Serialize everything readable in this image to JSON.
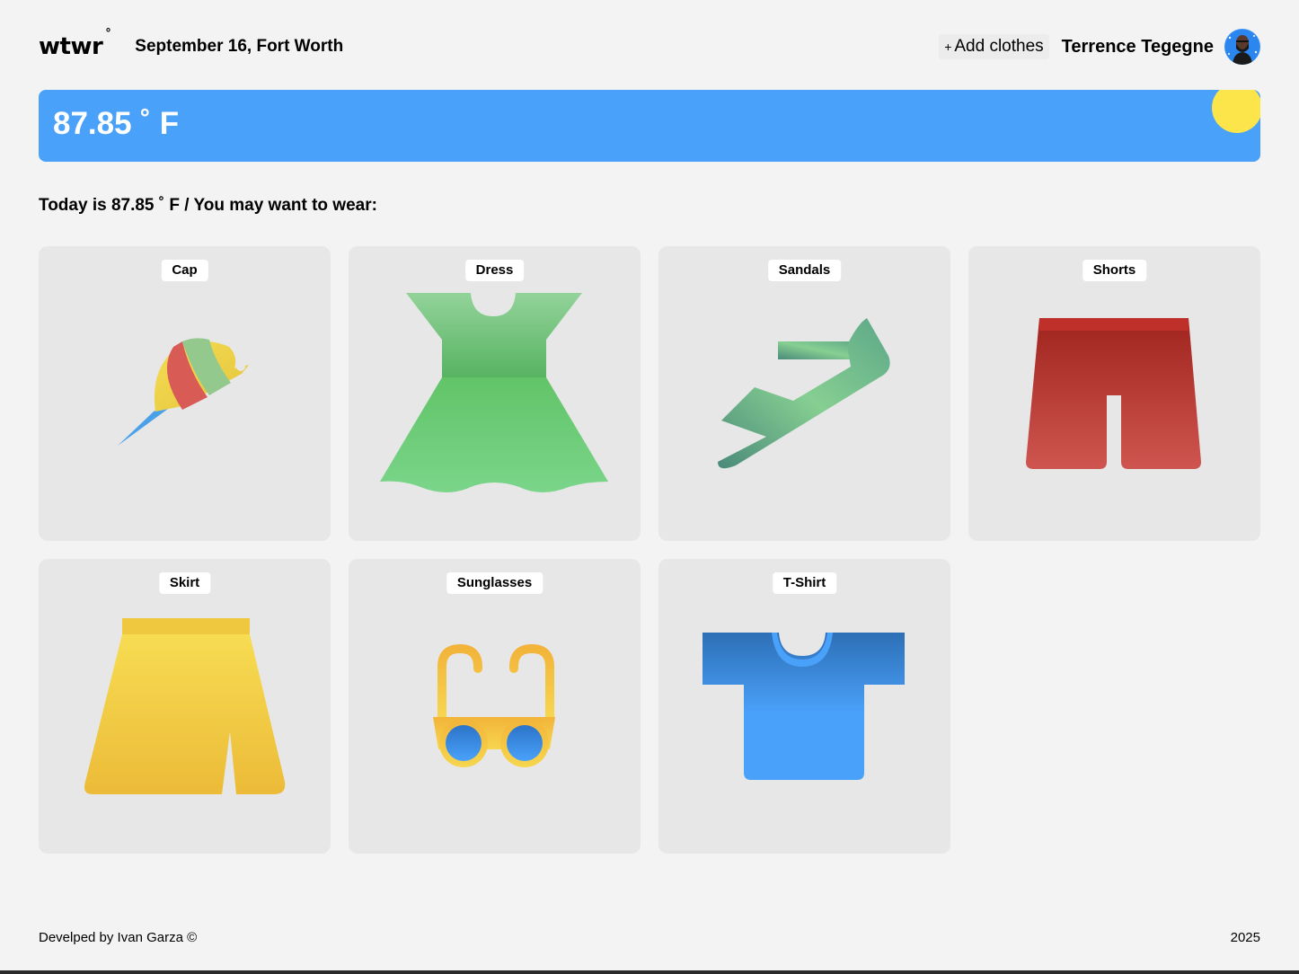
{
  "header": {
    "logo": "wtwr",
    "logo_degree": "°",
    "date_location": "September 16, Fort Worth",
    "add_button_icon": "+",
    "add_button_label": "Add clothes",
    "username": "Terrence Tegegne",
    "avatar_icon": "user-avatar"
  },
  "weather": {
    "temperature": "87.85 ˚ F",
    "condition_icon": "sun-icon",
    "card_color": "#4aa1fa",
    "sun_color": "#fce54a"
  },
  "recommendation": "Today is 87.85 ˚ F / You may want to wear:",
  "items": [
    {
      "name": "Cap",
      "icon": "cap-icon"
    },
    {
      "name": "Dress",
      "icon": "dress-icon"
    },
    {
      "name": "Sandals",
      "icon": "sandals-icon"
    },
    {
      "name": "Shorts",
      "icon": "shorts-icon"
    },
    {
      "name": "Skirt",
      "icon": "skirt-icon"
    },
    {
      "name": "Sunglasses",
      "icon": "sunglasses-icon"
    },
    {
      "name": "T-Shirt",
      "icon": "tshirt-icon"
    }
  ],
  "footer": {
    "credit": "Develped by Ivan Garza ©",
    "year": "2025"
  }
}
